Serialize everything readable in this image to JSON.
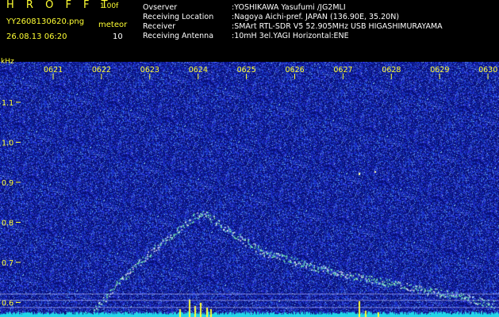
{
  "header": {
    "title": "H R O F F T",
    "version": "1.00f",
    "file_name": "YY2608130620.png",
    "timestamp": "26.08.13 06:20",
    "meteor_label": "meteor",
    "meteor_count": "10"
  },
  "station_info": [
    {
      "key": "Ovserver",
      "value": ":YOSHIKAWA Yasufumi /JG2MLI"
    },
    {
      "key": "Receiving Location",
      "value": ":Nagoya Aichi-pref. JAPAN (136.90E, 35.20N)"
    },
    {
      "key": "Receiver",
      "value": ":SMArt RTL-SDR V5 52.905MHz USB HIGASHIMURAYAMA"
    },
    {
      "key": "Receiving Antenna",
      "value": ":10mH 3el.YAGI Horizontal:ENE"
    }
  ],
  "spectrogram": {
    "unit_label": "kHz",
    "time_ticks": [
      "0621",
      "0622",
      "0623",
      "0624",
      "0625",
      "0626",
      "0627",
      "0628",
      "0629",
      "0630"
    ],
    "freq_ticks": [
      "1.1",
      "1.0",
      "0.9",
      "0.8",
      "0.7",
      "0.6"
    ],
    "colors": {
      "background": "#08107a",
      "noise": "#2a3cd0",
      "signal": "#7fffb0",
      "hot": "#ffff33",
      "axis": "#ffff33"
    }
  }
}
